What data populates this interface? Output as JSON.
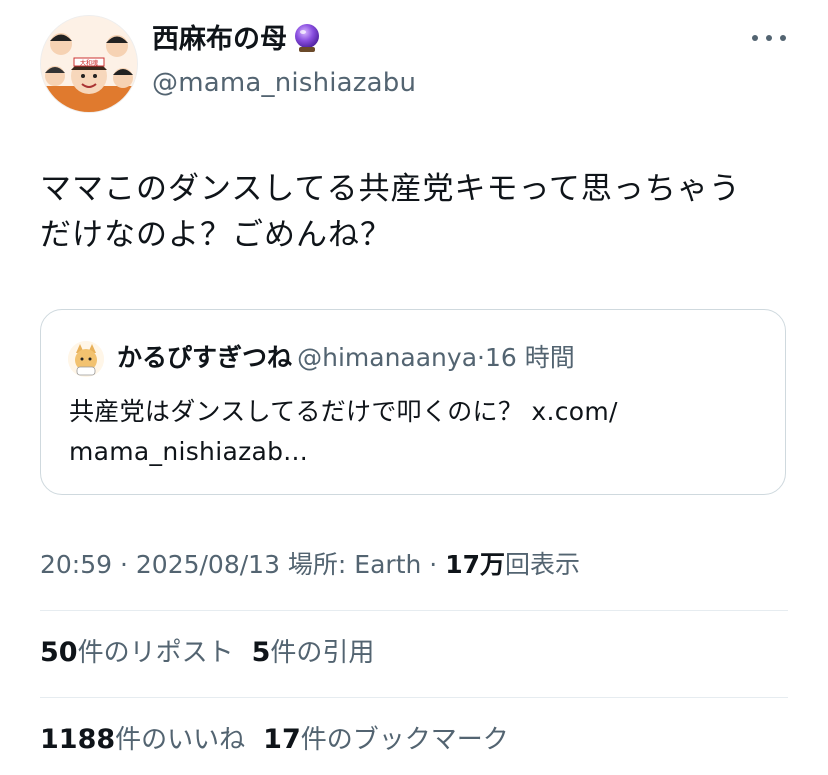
{
  "user": {
    "display_name": "西麻布の母",
    "handle": "@mama_nishiazabu",
    "avatar_banner_text": "大和魂"
  },
  "tweet": {
    "text_line1": "ママこのダンスしてる共産党キモって思っちゃう",
    "text_line2": "だけなのよ？ごめんね？"
  },
  "quote": {
    "name": "かるぴすぎつね",
    "handle": "@himanaanya",
    "separator": "·",
    "time": "16 時間",
    "text_line1": "共産党はダンスしてるだけで叩くのに？ x.com/",
    "text_line2": "mama_nishiazab..."
  },
  "meta": {
    "time": "20:59",
    "sep1": " · ",
    "date": "2025/08/13",
    "location": " 場所: Earth",
    "sep2": " · ",
    "views_count": "17万",
    "views_label": "回表示"
  },
  "stats": {
    "reposts_count": "50",
    "reposts_label": "件のリポスト",
    "quotes_count": "5",
    "quotes_label": "件の引用",
    "likes_count": "1188",
    "likes_label": "件のいいね",
    "bookmarks_count": "17",
    "bookmarks_label": "件のブックマーク"
  },
  "colors": {
    "text": "#0f1419",
    "secondary": "#536471",
    "border": "#cfd9de",
    "divider": "#e6ecf0",
    "orb": "#7b3fd0"
  },
  "icons": [
    "crystal-ball-icon",
    "more-icon"
  ]
}
